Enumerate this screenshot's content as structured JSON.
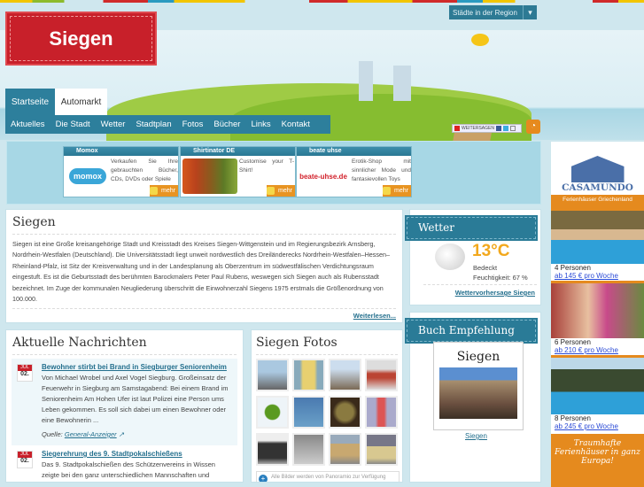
{
  "header": {
    "logo": "Siegen",
    "region_dropdown": "Städte in der Region",
    "tabs": [
      "Startseite",
      "Automarkt"
    ],
    "nav": [
      "Aktuelles",
      "Die Stadt",
      "Wetter",
      "Stadtplan",
      "Fotos",
      "Bücher",
      "Links",
      "Kontakt"
    ],
    "share": "WEITERSAGEN"
  },
  "ads": [
    {
      "title": "Momox",
      "logo": "momox",
      "text": "Verkaufen Sie Ihre gebrauchten Bücher, CDs, DVDs oder Spiele",
      "more": "mehr"
    },
    {
      "title": "Shirtinator DE",
      "text": "Customise your T-Shirt!",
      "more": "mehr"
    },
    {
      "title": "beate uhse",
      "logo": "beate-uhse.de",
      "text": "Erotik-Shop mit sinnlicher Mode und fantasievollen Toys",
      "more": "mehr"
    }
  ],
  "intro": {
    "title": "Siegen",
    "text": "Siegen ist eine Große kreisangehörige Stadt und Kreisstadt des Kreises Siegen-Wittgenstein und im Regierungsbezirk Arnsberg, Nordrhein-Westfalen (Deutschland). Die Universitätsstadt liegt unweit nordwestlich des Dreiländerecks Nordrhein-Westfalen–Hessen–Rheinland-Pfalz, ist Sitz der Kreisverwaltung und in der Landesplanung als Oberzentrum im südwestfälischen Verdichtungsraum eingestuft. Es ist die Geburtsstadt des berühmten Barockmalers Peter Paul Rubens, weswegen sich Siegen auch als Rubensstadt bezeichnet. Im Zuge der kommunalen Neugliederung überschritt die Einwohnerzahl Siegens 1975 erstmals die Größenordnung von 100.000.",
    "more": "Weiterlesen..."
  },
  "weather": {
    "title": "Wetter",
    "temp": "13°C",
    "condition": "Bedeckt",
    "humidity": "Feuchtigkeit: 67 %",
    "link": "Wettervorhersage Siegen"
  },
  "book": {
    "title": "Buch Empfehlung",
    "cover_title": "Siegen",
    "link": "Siegen"
  },
  "news": {
    "title": "Aktuelle Nachrichten",
    "items": [
      {
        "month": "JUL",
        "day": "02.",
        "title": "Bewohner stirbt bei Brand in Siegburger Seniorenheim",
        "text": "Von Michael Wrobel und Axel Vogel Siegburg. Großeinsatz der Feuerwehr in Siegburg am Samstagabend: Bei einem Brand im Seniorenheim Am Hohen Ufer ist laut Polizei eine Person ums Leben gekommen. Es soll sich dabei um einen Bewohner oder eine Bewohnerin ...",
        "source_label": "Quelle:",
        "source": "General-Anzeiger"
      },
      {
        "month": "JUL",
        "day": "02.",
        "title": "Siegerehrung des 9. Stadtpokalschießens",
        "text": "Das 9. Stadtpokalschießen des Schützenvereins in Wissen zeigte bei den ganz unterschiedlichen Mannschaften und"
      }
    ]
  },
  "photos": {
    "title": "Siegen Fotos",
    "note": "Alle Bilder werden von Panoramio zur Verfügung gestellt und unterliegen dem Copyright"
  },
  "casamundo": {
    "brand": "CASAMUNDO",
    "sub": "Ferienhäuser Griechenland",
    "offers": [
      {
        "persons": "4 Personen",
        "price": "ab 145 € pro Woche"
      },
      {
        "persons": "6 Personen",
        "price": "ab 210 € pro Woche"
      },
      {
        "persons": "8 Personen",
        "price": "ab 245 € pro Woche"
      }
    ],
    "slogan": "Traumhafte Ferienhäuser in ganz Europa!"
  }
}
